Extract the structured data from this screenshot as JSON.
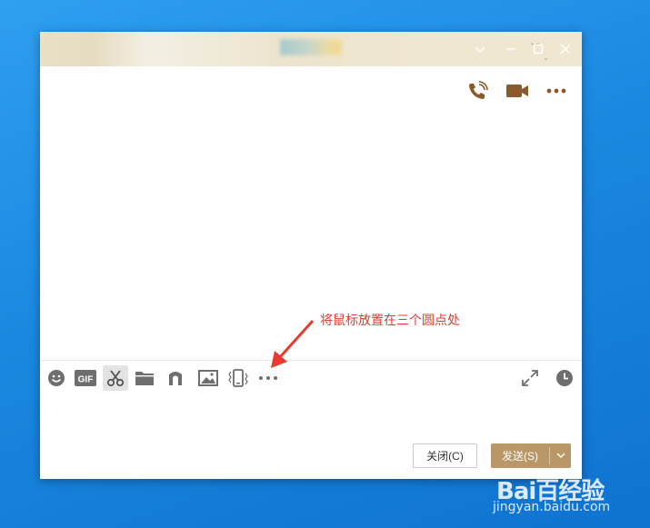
{
  "window": {
    "title": ""
  },
  "top_actions": {
    "voice_call_icon": "phone-icon",
    "video_call_icon": "video-camera-icon",
    "more_icon": "more-dots-icon"
  },
  "toolbar": {
    "items": [
      {
        "name": "emoji",
        "icon": "smiley-icon"
      },
      {
        "name": "gif",
        "icon": "gif-icon",
        "label": "GIF"
      },
      {
        "name": "screenshot",
        "icon": "scissors-icon"
      },
      {
        "name": "file",
        "icon": "folder-icon"
      },
      {
        "name": "music",
        "icon": "music-note-icon"
      },
      {
        "name": "image",
        "icon": "image-icon"
      },
      {
        "name": "shake",
        "icon": "shake-window-icon"
      },
      {
        "name": "more",
        "icon": "more-dots-icon"
      }
    ],
    "right": [
      {
        "name": "expand",
        "icon": "expand-icon"
      },
      {
        "name": "history",
        "icon": "clock-icon"
      }
    ]
  },
  "footer": {
    "close_label": "关闭(C)",
    "send_label": "发送(S)"
  },
  "annotation": {
    "text": "将鼠标放置在三个圆点处",
    "color": "#e63b2e"
  },
  "watermark": {
    "logo": "Bai百经验",
    "url": "jingyan.baidu.com"
  },
  "colors": {
    "accent": "#b99767",
    "icon": "#8b5a2b",
    "tool_icon": "#6e6e6e"
  }
}
